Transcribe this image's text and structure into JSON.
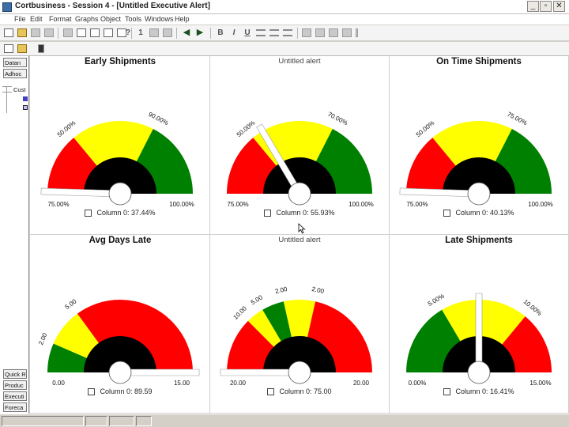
{
  "window": {
    "title": "Cortbusiness - Session 4 - [Untitled Executive Alert]",
    "minimize": "_",
    "maximize": "▫",
    "close": "✕"
  },
  "menu": [
    "File",
    "Edit",
    "Format",
    "Graphs",
    "Object",
    "Tools",
    "Windows",
    "Help"
  ],
  "toolbar": {
    "bold": "B",
    "italic": "I",
    "underline": "U",
    "help": "?",
    "info": "1"
  },
  "left_panel": {
    "top_buttons": [
      "Datan",
      "Adhoc"
    ],
    "tree_label": "Cust",
    "bottom_buttons": [
      "Quick R",
      "Produc",
      "Executi",
      "Foreca"
    ]
  },
  "gauges": [
    {
      "title": "Early Shipments",
      "title_style": "bold",
      "bands": [
        "red",
        "yellow",
        "green"
      ],
      "band_edges": [
        0,
        0.28,
        0.65,
        1
      ],
      "needle": 0.01,
      "left_tick": "50.00%",
      "right_tick": "90.00%",
      "min_label": "75.00%",
      "max_label": "100.00%",
      "footer": "Column 0: 37.44%"
    },
    {
      "title": "Untitled alert",
      "title_style": "light",
      "bands": [
        "red",
        "yellow",
        "green"
      ],
      "band_edges": [
        0,
        0.28,
        0.65,
        1
      ],
      "needle": 0.33,
      "left_tick": "50.00%",
      "right_tick": "70.00%",
      "min_label": "75.00%",
      "max_label": "100.00%",
      "footer": "Column 0: 55.93%"
    },
    {
      "title": "On Time Shipments",
      "title_style": "bold",
      "bands": [
        "red",
        "yellow",
        "green"
      ],
      "band_edges": [
        0,
        0.28,
        0.65,
        1
      ],
      "needle": 0.01,
      "left_tick": "50.00%",
      "right_tick": "75.00%",
      "min_label": "75.00%",
      "max_label": "100.00%",
      "footer": "Column 0: 40.13%"
    },
    {
      "title": "Avg Days Late",
      "title_style": "bold",
      "bands": [
        "green",
        "yellow",
        "red"
      ],
      "band_edges": [
        0,
        0.13,
        0.3,
        1
      ],
      "needle": 1.0,
      "left_tick": "2.00",
      "right_tick": "5.00",
      "min_label": "0.00",
      "max_label": "15.00",
      "footer": "Column 0: 89.59"
    },
    {
      "title": "Untitled alert",
      "title_style": "light",
      "bands": [
        "red",
        "yellow",
        "green",
        "yellow",
        "red"
      ],
      "band_edges": [
        0,
        0.25,
        0.33,
        0.43,
        0.57,
        1
      ],
      "needle": 0.0,
      "left_tick": "10.00",
      "right_tick": "2.00",
      "extra_ticks": [
        "5.00",
        "2.00"
      ],
      "min_label": "20.00",
      "max_label": "20.00",
      "footer": "Column 0: 75.00"
    },
    {
      "title": "Late Shipments",
      "title_style": "bold",
      "bands": [
        "green",
        "yellow",
        "red"
      ],
      "band_edges": [
        0,
        0.33,
        0.72,
        1
      ],
      "needle": 0.5,
      "left_tick": "5.00%",
      "right_tick": "10.00%",
      "min_label": "0.00%",
      "max_label": "15.00%",
      "footer": "Column 0: 16.41%"
    }
  ],
  "colors": {
    "red": "#ff0000",
    "yellow": "#ffff00",
    "green": "#008000",
    "hub": "#000000",
    "needle_fill": "#ffffff"
  }
}
